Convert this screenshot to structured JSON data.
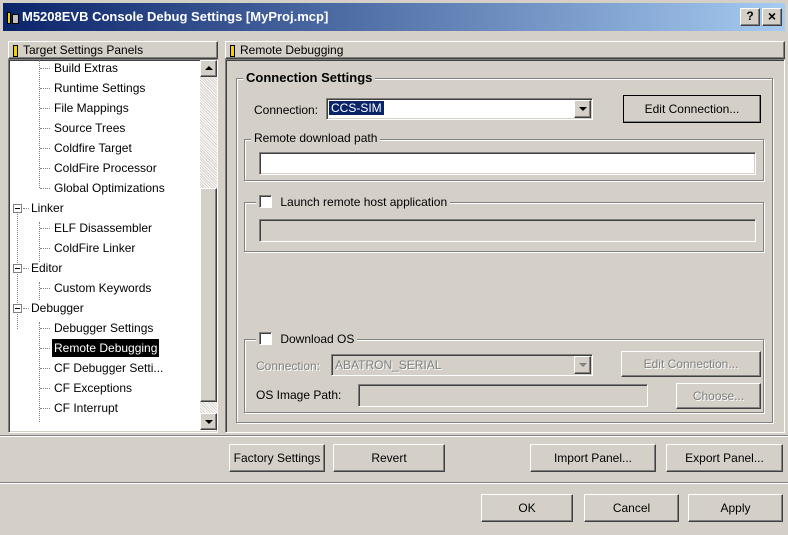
{
  "window": {
    "title": "M5208EVB Console Debug Settings [MyProj.mcp]",
    "help_glyph": "?",
    "close_glyph": "×"
  },
  "left_panel": {
    "header": "Target Settings Panels",
    "items": [
      {
        "label": "Build Extras",
        "level": 1
      },
      {
        "label": "Runtime Settings",
        "level": 1
      },
      {
        "label": "File Mappings",
        "level": 1
      },
      {
        "label": "Source Trees",
        "level": 1
      },
      {
        "label": "Coldfire Target",
        "level": 1
      },
      {
        "label": "ColdFire Processor",
        "level": 1
      },
      {
        "label": "Global Optimizations",
        "level": 1
      },
      {
        "label": "Linker",
        "level": 0
      },
      {
        "label": "ELF Disassembler",
        "level": 1
      },
      {
        "label": "ColdFire Linker",
        "level": 1
      },
      {
        "label": "Editor",
        "level": 0
      },
      {
        "label": "Custom Keywords",
        "level": 1
      },
      {
        "label": "Debugger",
        "level": 0
      },
      {
        "label": "Debugger Settings",
        "level": 1
      },
      {
        "label": "Remote Debugging",
        "level": 1,
        "selected": true
      },
      {
        "label": "CF Debugger Setti...",
        "level": 1
      },
      {
        "label": "CF Exceptions",
        "level": 1
      },
      {
        "label": "CF Interrupt",
        "level": 1
      }
    ]
  },
  "right_panel": {
    "header": "Remote Debugging",
    "connection_settings": {
      "title": "Connection Settings",
      "connection_label": "Connection:",
      "connection_value": "CCS-SIM",
      "edit_connection": "Edit Connection...",
      "remote_download_path_label": "Remote download path",
      "remote_download_path_value": "",
      "launch_remote_label": "Launch remote host application",
      "launch_remote_value": ""
    },
    "download_os": {
      "label": "Download OS",
      "connection_label": "Connection:",
      "connection_value": "ABATRON_SERIAL",
      "edit_connection": "Edit Connection...",
      "os_image_path_label": "OS Image Path:",
      "os_image_path_value": "",
      "choose": "Choose..."
    }
  },
  "panel_buttons": {
    "factory_settings": "Factory Settings",
    "revert": "Revert",
    "import_panel": "Import Panel...",
    "export_panel": "Export Panel..."
  },
  "dialog_buttons": {
    "ok": "OK",
    "cancel": "Cancel",
    "apply": "Apply"
  },
  "colors": {
    "titlebar": "#0a246a",
    "face": "#d4d0c8",
    "selection": "#000000",
    "connection_highlight": "#0a246a"
  }
}
